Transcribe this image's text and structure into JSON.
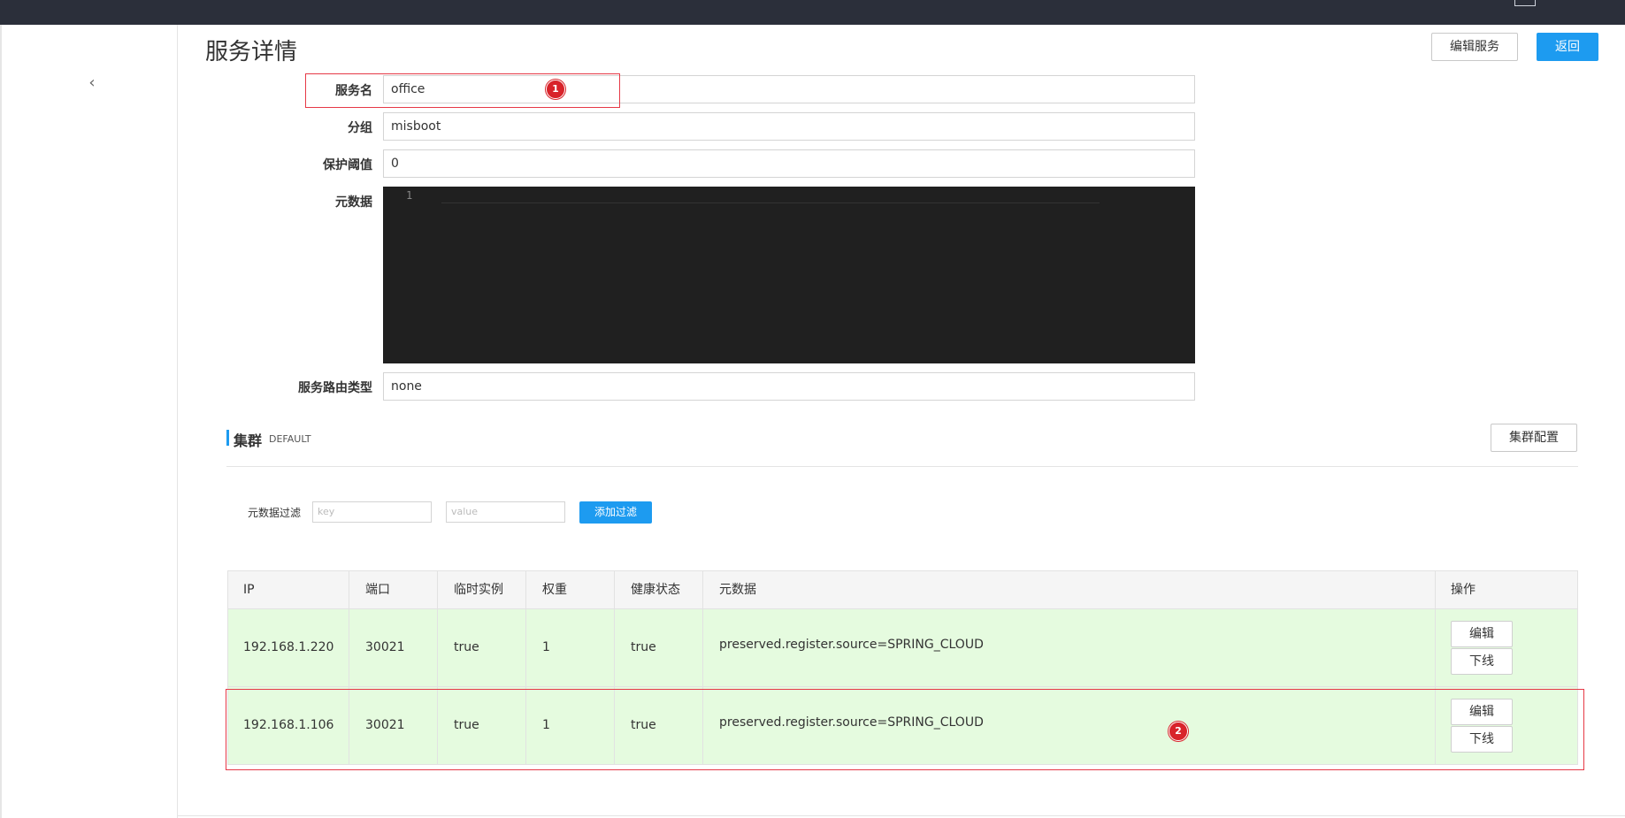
{
  "header": {
    "title": "服务详情",
    "edit_service_label": "编辑服务",
    "back_label": "返回"
  },
  "sidebar": {
    "collapse_icon": "chevron-left-icon"
  },
  "form": {
    "service_name": {
      "label": "服务名",
      "value": "office"
    },
    "group": {
      "label": "分组",
      "value": "misboot"
    },
    "protect_threshold": {
      "label": "保护阈值",
      "value": "0"
    },
    "metadata": {
      "label": "元数据",
      "line_number": "1"
    },
    "route_type": {
      "label": "服务路由类型",
      "value": "none"
    }
  },
  "cluster": {
    "title": "集群",
    "name": "DEFAULT",
    "config_label": "集群配置"
  },
  "filter": {
    "label": "元数据过滤",
    "key_placeholder": "key",
    "value_placeholder": "value",
    "add_label": "添加过滤"
  },
  "table": {
    "columns": [
      "IP",
      "端口",
      "临时实例",
      "权重",
      "健康状态",
      "元数据",
      "操作"
    ],
    "rows": [
      {
        "ip": "192.168.1.220",
        "port": "30021",
        "ephemeral": "true",
        "weight": "1",
        "healthy": "true",
        "metadata": "preserved.register.source=SPRING_CLOUD",
        "edit": "编辑",
        "offline": "下线"
      },
      {
        "ip": "192.168.1.106",
        "port": "30021",
        "ephemeral": "true",
        "weight": "1",
        "healthy": "true",
        "metadata": "preserved.register.source=SPRING_CLOUD",
        "edit": "编辑",
        "offline": "下线"
      }
    ]
  },
  "annotations": {
    "first": "1",
    "second": "2",
    "color": "#e63946"
  }
}
